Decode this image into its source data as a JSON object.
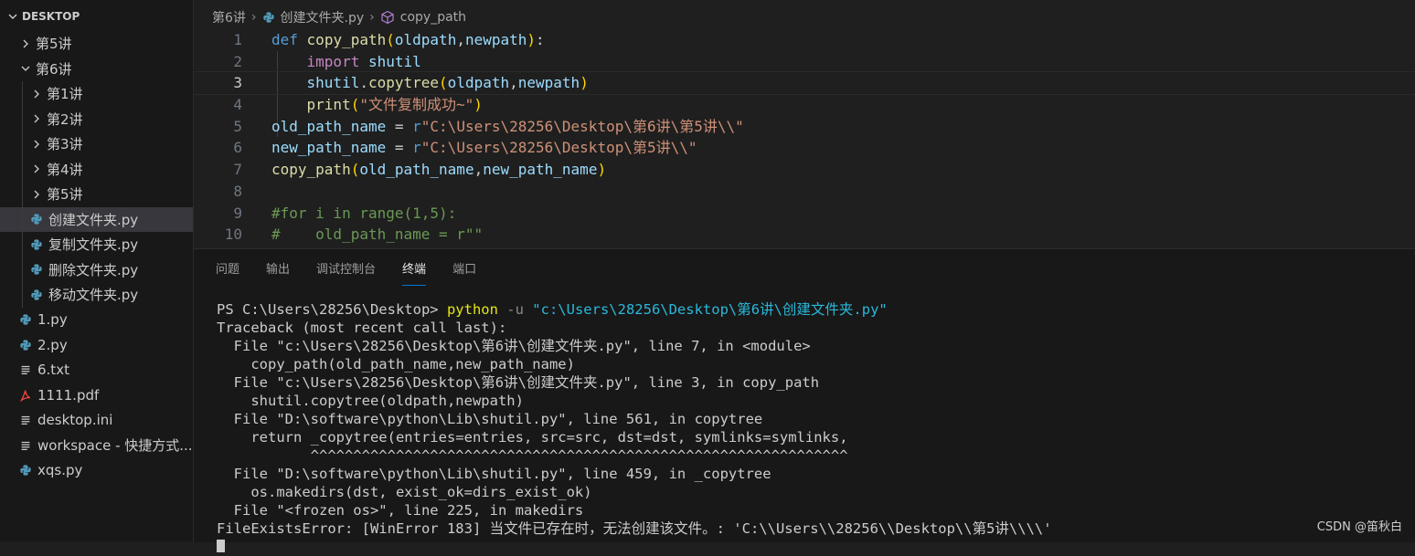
{
  "explorer": {
    "title": "DESKTOP",
    "items": [
      {
        "label": "第5讲",
        "type": "folder",
        "expanded": false,
        "depth": 0
      },
      {
        "label": "第6讲",
        "type": "folder",
        "expanded": true,
        "depth": 0
      },
      {
        "label": "第1讲",
        "type": "folder",
        "expanded": false,
        "depth": 1
      },
      {
        "label": "第2讲",
        "type": "folder",
        "expanded": false,
        "depth": 1
      },
      {
        "label": "第3讲",
        "type": "folder",
        "expanded": false,
        "depth": 1
      },
      {
        "label": "第4讲",
        "type": "folder",
        "expanded": false,
        "depth": 1
      },
      {
        "label": "第5讲",
        "type": "folder",
        "expanded": false,
        "depth": 1
      },
      {
        "label": "创建文件夹.py",
        "type": "python",
        "depth": 1,
        "selected": true
      },
      {
        "label": "复制文件夹.py",
        "type": "python",
        "depth": 1
      },
      {
        "label": "删除文件夹.py",
        "type": "python",
        "depth": 1
      },
      {
        "label": "移动文件夹.py",
        "type": "python",
        "depth": 1
      },
      {
        "label": "1.py",
        "type": "python",
        "depth": 0
      },
      {
        "label": "2.py",
        "type": "python",
        "depth": 0
      },
      {
        "label": "6.txt",
        "type": "text",
        "depth": 0
      },
      {
        "label": "1111.pdf",
        "type": "pdf",
        "depth": 0
      },
      {
        "label": "desktop.ini",
        "type": "text",
        "depth": 0
      },
      {
        "label": "workspace - 快捷方式...",
        "type": "text",
        "depth": 0
      },
      {
        "label": "xqs.py",
        "type": "python",
        "depth": 0
      }
    ]
  },
  "breadcrumb": {
    "folder": "第6讲",
    "file": "创建文件夹.py",
    "symbol": "copy_path"
  },
  "editor": {
    "current_line": 3,
    "lines": [
      {
        "n": "1",
        "tokens": [
          [
            "kw",
            "def"
          ],
          [
            "pl",
            " "
          ],
          [
            "fn",
            "copy_path"
          ],
          [
            "par1",
            "("
          ],
          [
            "var",
            "oldpath"
          ],
          [
            "pl",
            ","
          ],
          [
            "var",
            "newpath"
          ],
          [
            "par1",
            ")"
          ],
          [
            "pl",
            ":"
          ]
        ]
      },
      {
        "n": "2",
        "tokens": [
          [
            "pl",
            "    "
          ],
          [
            "kw2",
            "import"
          ],
          [
            "pl",
            " "
          ],
          [
            "var",
            "shutil"
          ]
        ]
      },
      {
        "n": "3",
        "tokens": [
          [
            "pl",
            "    "
          ],
          [
            "var",
            "shutil"
          ],
          [
            "pl",
            "."
          ],
          [
            "fn",
            "copytree"
          ],
          [
            "par1",
            "("
          ],
          [
            "var",
            "oldpath"
          ],
          [
            "pl",
            ","
          ],
          [
            "var",
            "newpath"
          ],
          [
            "par1",
            ")"
          ]
        ]
      },
      {
        "n": "4",
        "tokens": [
          [
            "pl",
            "    "
          ],
          [
            "fn",
            "print"
          ],
          [
            "par1",
            "("
          ],
          [
            "str",
            "\"文件复制成功~\""
          ],
          [
            "par1",
            ")"
          ]
        ]
      },
      {
        "n": "5",
        "tokens": [
          [
            "var",
            "old_path_name"
          ],
          [
            "pl",
            " = "
          ],
          [
            "kw",
            "r"
          ],
          [
            "str",
            "\"C:\\Users\\28256\\Desktop\\第6讲\\第5讲\\\\\""
          ]
        ]
      },
      {
        "n": "6",
        "tokens": [
          [
            "var",
            "new_path_name"
          ],
          [
            "pl",
            " = "
          ],
          [
            "kw",
            "r"
          ],
          [
            "str",
            "\"C:\\Users\\28256\\Desktop\\第5讲\\\\\""
          ]
        ]
      },
      {
        "n": "7",
        "tokens": [
          [
            "fn",
            "copy_path"
          ],
          [
            "par1",
            "("
          ],
          [
            "var",
            "old_path_name"
          ],
          [
            "pl",
            ","
          ],
          [
            "var",
            "new_path_name"
          ],
          [
            "par1",
            ")"
          ]
        ]
      },
      {
        "n": "8",
        "tokens": []
      },
      {
        "n": "9",
        "tokens": [
          [
            "cmt",
            "#for i in range(1,5):"
          ]
        ]
      },
      {
        "n": "10",
        "tokens": [
          [
            "cmt",
            "#    old_path_name = r\"\""
          ]
        ]
      }
    ]
  },
  "panel": {
    "tabs": [
      {
        "label": "问题",
        "active": false
      },
      {
        "label": "输出",
        "active": false
      },
      {
        "label": "调试控制台",
        "active": false
      },
      {
        "label": "终端",
        "active": true
      },
      {
        "label": "端口",
        "active": false
      }
    ]
  },
  "terminal": {
    "prompt": "PS C:\\Users\\28256\\Desktop> ",
    "command": "python",
    "flag": " -u ",
    "arg": "\"c:\\Users\\28256\\Desktop\\第6讲\\创建文件夹.py\"",
    "output": [
      "Traceback (most recent call last):",
      "  File \"c:\\Users\\28256\\Desktop\\第6讲\\创建文件夹.py\", line 7, in <module>",
      "    copy_path(old_path_name,new_path_name)",
      "  File \"c:\\Users\\28256\\Desktop\\第6讲\\创建文件夹.py\", line 3, in copy_path",
      "    shutil.copytree(oldpath,newpath)",
      "  File \"D:\\software\\python\\Lib\\shutil.py\", line 561, in copytree",
      "    return _copytree(entries=entries, src=src, dst=dst, symlinks=symlinks,",
      "           ^^^^^^^^^^^^^^^^^^^^^^^^^^^^^^^^^^^^^^^^^^^^^^^^^^^^^^^^^^^^^^^",
      "  File \"D:\\software\\python\\Lib\\shutil.py\", line 459, in _copytree",
      "    os.makedirs(dst, exist_ok=dirs_exist_ok)",
      "  File \"<frozen os>\", line 225, in makedirs",
      "FileExistsError: [WinError 183] 当文件已存在时，无法创建该文件。: 'C:\\\\Users\\\\28256\\\\Desktop\\\\第5讲\\\\\\\\'"
    ]
  },
  "watermark": "CSDN @笛秋白",
  "colors": {
    "background": "#1f1f1f",
    "sidebar": "#181818",
    "selection": "#37373d",
    "accent": "#0078d4",
    "python_icon": "#519aba",
    "pdf_icon": "#e8453c"
  }
}
